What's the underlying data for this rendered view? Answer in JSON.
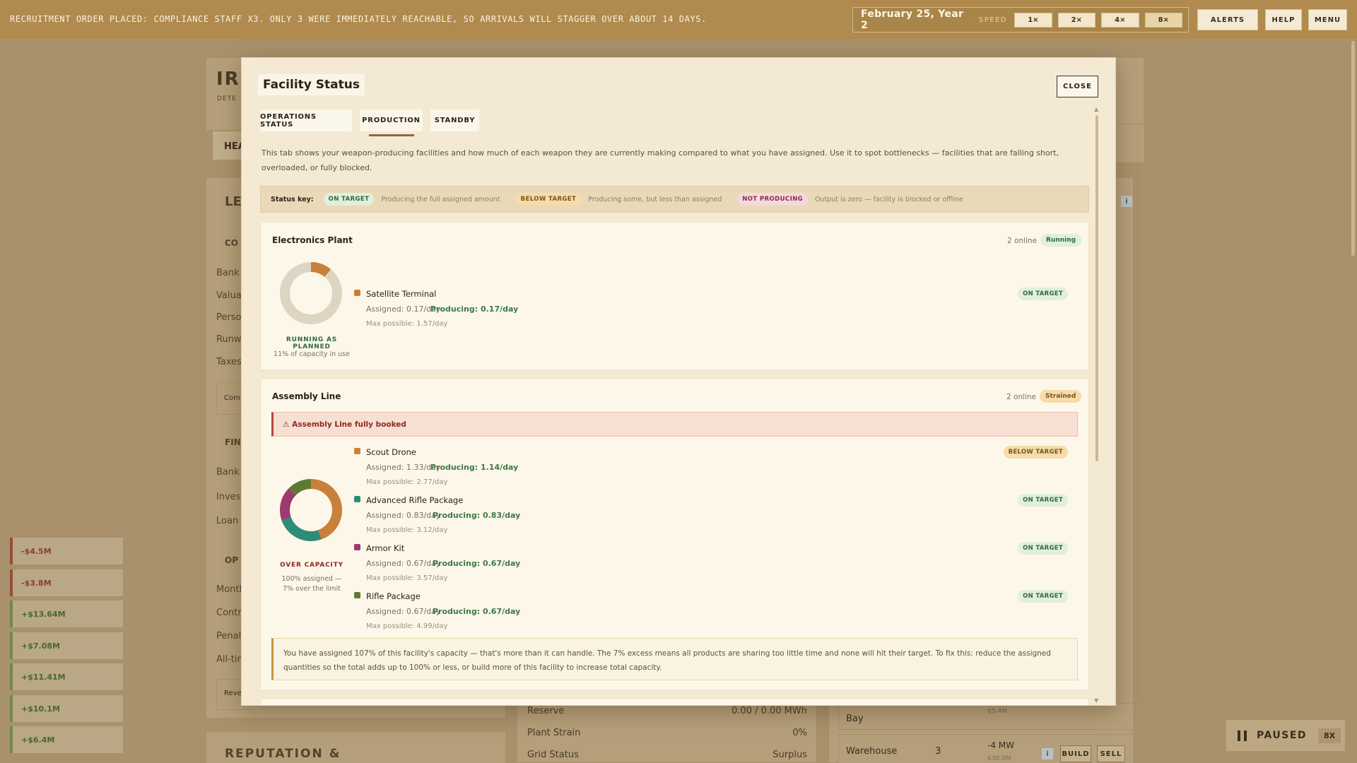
{
  "topbar": {
    "ticker": "RECRUITMENT ORDER PLACED: COMPLIANCE STAFF X3. ONLY 3 WERE IMMEDIATELY REACHABLE, SO ARRIVALS WILL STAGGER OVER ABOUT 14 DAYS.",
    "date": "February 25, Year 2",
    "speed_label": "SPEED",
    "speeds": [
      "1×",
      "2×",
      "4×",
      "8×"
    ],
    "alerts": "ALERTS",
    "help": "HELP",
    "menu": "MENU"
  },
  "background": {
    "title_fragment": "IR",
    "subtitle_fragment": "DETE",
    "tab_fragment": "HEA",
    "section_le": "LE",
    "section_co": "CO",
    "rows_left": [
      "Bank I",
      "Valua",
      "Perso",
      "Runwa",
      "Taxes"
    ],
    "comp_fragment": "Com",
    "section_fin": "FIN",
    "fin_rows": [
      "Bank I",
      "Invest",
      "Loan I"
    ],
    "section_op": "OP",
    "op_rows": [
      "Month",
      "Contr",
      "Penal",
      "All-tim"
    ],
    "reve_fragment": "Reve",
    "reputation": "REPUTATION &",
    "side_chips": [
      "-$4.5M",
      "-$3.8M",
      "+$13.64M",
      "+$7.08M",
      "+$11.41M",
      "+$10.1M",
      "+$6.4M"
    ],
    "stats": [
      {
        "label": "Reserve",
        "value": "0.00 / 0.00 MWh"
      },
      {
        "label": "Plant Strain",
        "value": "0%"
      },
      {
        "label": "Grid Status",
        "value": "Surplus"
      }
    ],
    "bay": "Bay",
    "bay_cost": "$5.4M",
    "warehouse": {
      "name": "Warehouse",
      "count": "3",
      "power": "-4 MW",
      "cost": "$30.0M",
      "info": "i",
      "build": "BUILD",
      "sell": "SELL"
    },
    "paused": "PAUSED",
    "paused_speed": "8X",
    "info_glyph": "i"
  },
  "modal": {
    "title": "Facility Status",
    "close": "CLOSE",
    "tabs": [
      "OPERATIONS STATUS",
      "PRODUCTION",
      "STANDBY"
    ],
    "active_tab": "PRODUCTION",
    "intro": "This tab shows your weapon-producing facilities and how much of each weapon they are currently making compared to what you have assigned. Use it to spot bottlenecks — facilities that are falling short, overloaded, or fully blocked.",
    "status_key": {
      "label": "Status key:",
      "items": [
        {
          "pill": "ON TARGET",
          "desc": "Producing the full assigned amount"
        },
        {
          "pill": "BELOW TARGET",
          "desc": "Producing some, but less than assigned"
        },
        {
          "pill": "NOT PRODUCING",
          "desc": "Output is zero — facility is blocked or offline"
        }
      ]
    },
    "facilities": [
      {
        "name": "Electronics Plant",
        "online": "2 online",
        "status": "Running",
        "donut_label": "RUNNING AS PLANNED",
        "donut_sub": "11% of capacity in use",
        "capacity_used": 0.11,
        "products": [
          {
            "name": "Satellite Terminal",
            "assigned": "Assigned: 0.17/day",
            "producing": "Producing: 0.17/day",
            "max": "Max possible: 1.57/day",
            "status": "ON TARGET",
            "color": "#c9803a"
          }
        ]
      },
      {
        "name": "Assembly Line",
        "online": "2 online",
        "status": "Strained",
        "alert": "⚠ Assembly Line fully booked",
        "donut_label": "OVER CAPACITY",
        "donut_sub": "100% assigned — 7% over the limit",
        "products": [
          {
            "name": "Scout Drone",
            "assigned": "Assigned: 1.33/day",
            "producing": "Producing: 1.14/day",
            "max": "Max possible: 2.77/day",
            "status": "BELOW TARGET",
            "color": "#c9803a",
            "share": 0.48
          },
          {
            "name": "Advanced Rifle Package",
            "assigned": "Assigned: 0.83/day",
            "producing": "Producing: 0.83/day",
            "max": "Max possible: 3.12/day",
            "status": "ON TARGET",
            "color": "#2e8b77",
            "share": 0.27
          },
          {
            "name": "Armor Kit",
            "assigned": "Assigned: 0.67/day",
            "producing": "Producing: 0.67/day",
            "max": "Max possible: 3.57/day",
            "status": "ON TARGET",
            "color": "#9c3a6e",
            "share": 0.19
          },
          {
            "name": "Rifle Package",
            "assigned": "Assigned: 0.67/day",
            "producing": "Producing: 0.67/day",
            "max": "Max possible: 4.99/day",
            "status": "ON TARGET",
            "color": "#5e7a32",
            "share": 0.14
          }
        ],
        "note": "You have assigned 107% of this facility's capacity — that's more than it can handle. The 7% excess means all products are sharing too little time and none will hit their target. To fix this: reduce the assigned quantities so the total adds up to 100% or less, or build more of this facility to increase total capacity."
      }
    ]
  }
}
